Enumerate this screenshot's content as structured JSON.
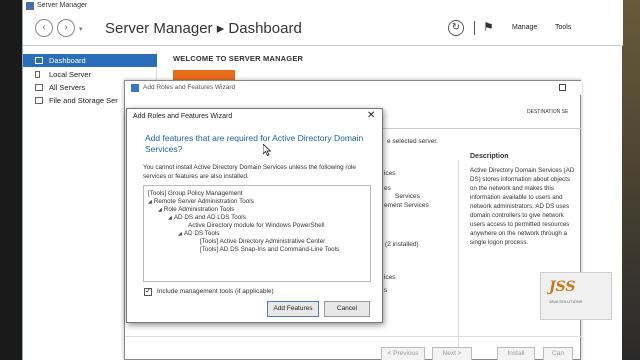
{
  "window": {
    "title": "Server Manager"
  },
  "header": {
    "heading": "Server Manager ▸ Dashboard",
    "menu": {
      "manage": "Manage",
      "tools": "Tools"
    }
  },
  "sidebar": {
    "items": [
      {
        "label": "Dashboard",
        "active": true
      },
      {
        "label": "Local Server"
      },
      {
        "label": "All Servers"
      },
      {
        "label": "File and Storage Ser"
      }
    ]
  },
  "main": {
    "welcome": "WELCOME TO SERVER MANAGER"
  },
  "wizard": {
    "title": "Add Roles and Features Wizard",
    "destination": "DESTINATION SE",
    "selected_server": "e selected server.",
    "description_heading": "Description",
    "description_text": "Active Directory Domain Services (AD DS) stores information about objects on the network and makes this information available to users and network administrators. AD DS uses domain controllers to give network users access to permitted resources anywhere on the network through a single logon process.",
    "fragments": [
      "ices",
      "es",
      "Services",
      "ement Services",
      "(2 installed)",
      "ices",
      "s"
    ],
    "buttons": {
      "previous": "< Previous",
      "next": "Next >",
      "install": "Install",
      "cancel": "Can"
    }
  },
  "dialog": {
    "title": "Add Roles and Features Wizard",
    "heading": "Add features that are required for Active Directory Domain Services?",
    "info": "You cannot install Active Directory Domain Services unless the following role services or features are also installed.",
    "tree": [
      "[Tools] Group Policy Management",
      "Remote Server Administration Tools",
      "Role Administration Tools",
      "AD DS and AD LDS Tools",
      "Active Directory module for Windows PowerShell",
      "AD DS Tools",
      "[Tools] Active Directory Administrative Center",
      "[Tools] AD DS Snap-Ins and Command-Line Tools"
    ],
    "include_mgmt_label": "Include management tools (if applicable)",
    "include_mgmt_checked": true,
    "add_features_label": "Add Features",
    "cancel_label": "Cancel"
  },
  "logo": {
    "text": "JSS",
    "sub": "JAVA SOLUTIONS"
  }
}
